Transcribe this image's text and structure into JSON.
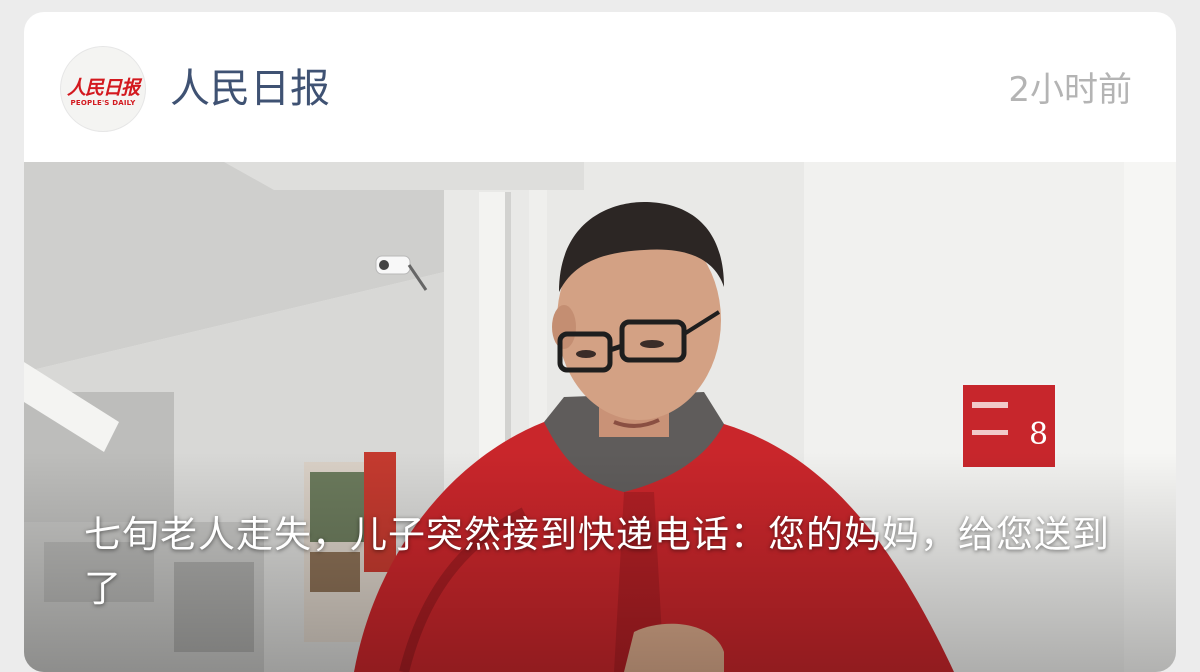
{
  "post": {
    "source_name": "人民日报",
    "timestamp": "2小时前",
    "avatar": {
      "logo_text": "人民日报",
      "logo_subtext": "PEOPLE'S DAILY",
      "brand_color": "#d3191f"
    },
    "headline": "七旬老人走失，儿子突然接到快递电话：您的妈妈，给您送到了",
    "image": {
      "sign_number": "8"
    }
  },
  "colors": {
    "source_name": "#3f5273",
    "timestamp": "#b4b4b4",
    "jacket_red": "#c9262b"
  }
}
